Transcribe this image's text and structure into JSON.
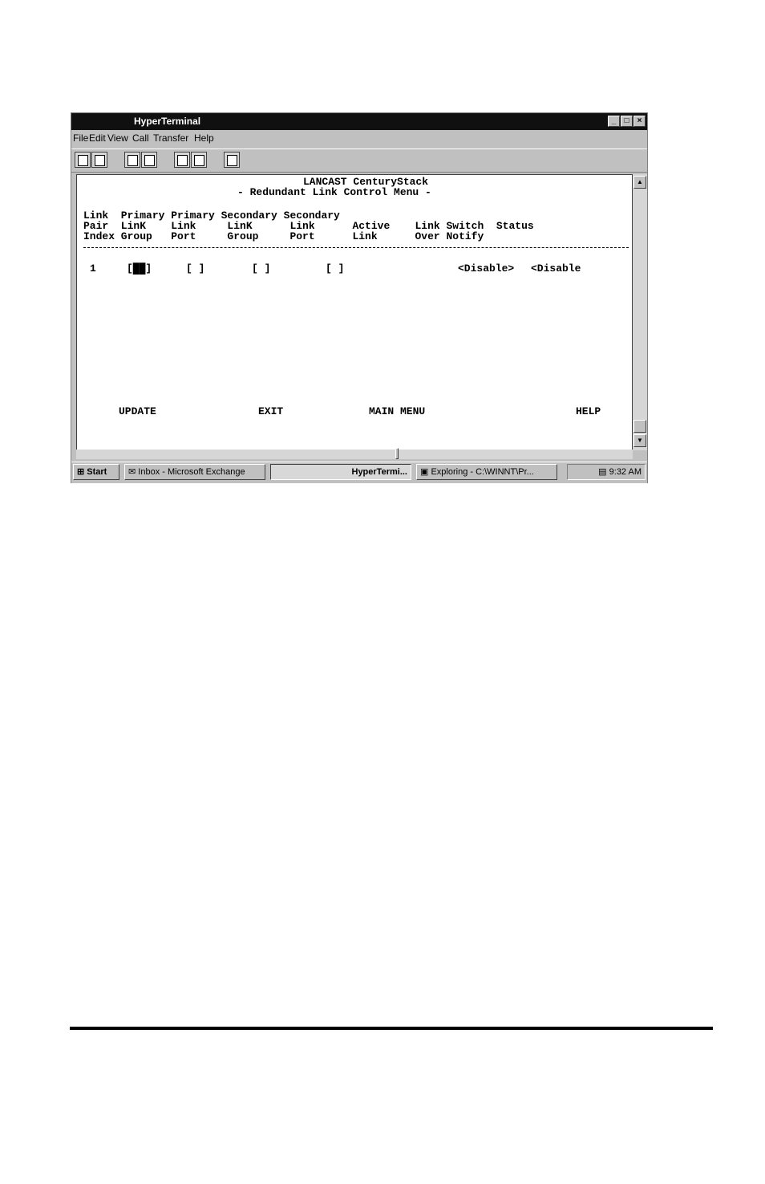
{
  "window": {
    "title": "HyperTerminal",
    "controls": {
      "minimize": "_",
      "maximize": "□",
      "close": "×"
    }
  },
  "menubar": {
    "items": [
      "File",
      "Edit",
      "View",
      "Call",
      "Transfer",
      "Help"
    ]
  },
  "terminal": {
    "title_line": "LANCAST CenturyStack",
    "subtitle_line": "- Redundant Link Control Menu -",
    "header_line1": "Link  Primary Primary Secondary Secondary",
    "header_line2": "Pair  LinK    Link     LinK      Link      Active    Link Switch  Status",
    "header_line3": "Index Group   Port     Group     Port      Link      Over Notify",
    "row": {
      "index": "1",
      "primary_group": "[██]",
      "primary_port": "[ ]",
      "secondary_group": "[ ]",
      "secondary_port": "[ ]",
      "link_over": "<Disable>",
      "switch_notify": "<Disable"
    },
    "commands": {
      "update": "UPDATE",
      "exit": "EXIT",
      "main_menu": "MAIN MENU",
      "help": "HELP"
    }
  },
  "taskbar": {
    "start": "Start",
    "tasks": [
      "Inbox - Microsoft Exchange",
      "HyperTermi...",
      "Exploring - C:\\WINNT\\Pr..."
    ],
    "clock": "9:32 AM"
  }
}
